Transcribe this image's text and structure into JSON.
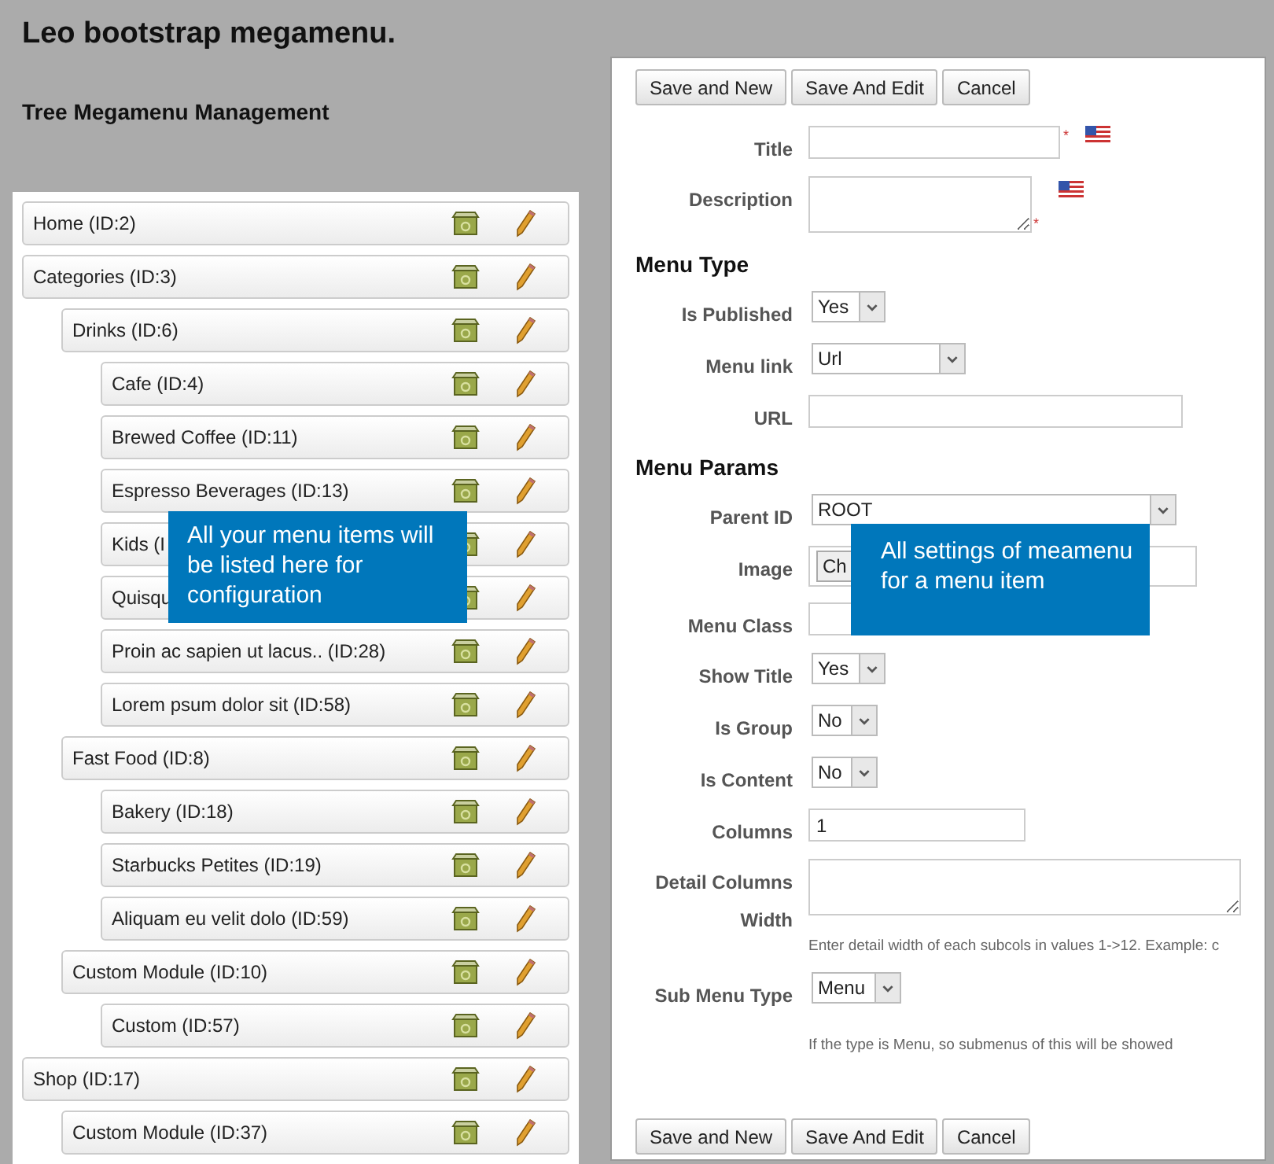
{
  "page_title": "Leo bootstrap megamenu.",
  "tree_title": "Tree Megamenu Management",
  "tree": [
    {
      "label": "Home (ID:2)"
    },
    {
      "label": "Categories (ID:3)",
      "children": [
        {
          "label": "Drinks (ID:6)",
          "children": [
            {
              "label": "Cafe (ID:4)"
            },
            {
              "label": "Brewed Coffee (ID:11)"
            },
            {
              "label": "Espresso Beverages (ID:13)"
            },
            {
              "label": "Kids (I"
            },
            {
              "label": "Quisqu"
            },
            {
              "label": "Proin ac sapien ut lacus.. (ID:28)"
            },
            {
              "label": "Lorem psum dolor sit (ID:58)"
            }
          ]
        },
        {
          "label": "Fast Food (ID:8)",
          "children": [
            {
              "label": "Bakery (ID:18)"
            },
            {
              "label": "Starbucks Petites (ID:19)"
            },
            {
              "label": "Aliquam eu velit dolo (ID:59)"
            }
          ]
        },
        {
          "label": "Custom Module (ID:10)",
          "children": [
            {
              "label": "Custom (ID:57)"
            }
          ]
        }
      ]
    },
    {
      "label": "Shop (ID:17)",
      "children": [
        {
          "label": "Custom Module (ID:37)"
        }
      ]
    }
  ],
  "tree_callout": "All your menu items will be listed here for configuration",
  "buttons_top": [
    "Save and New",
    "Save And Edit",
    "Cancel"
  ],
  "form_rows": [
    {
      "kind": "text",
      "label": "Title",
      "required_mark": "*",
      "flag": true
    },
    {
      "kind": "textarea",
      "label": "Description",
      "required_mark": "*",
      "flag": true
    },
    {
      "kind": "heading",
      "text": "Menu Type"
    },
    {
      "kind": "select",
      "label": "Is Published",
      "value": "Yes"
    },
    {
      "kind": "select",
      "label": "Menu link",
      "value": "Url"
    },
    {
      "kind": "text",
      "label": "URL"
    },
    {
      "kind": "heading",
      "text": "Menu Params"
    },
    {
      "kind": "select",
      "label": "Parent ID",
      "value": "ROOT"
    },
    {
      "kind": "file",
      "label": "Image",
      "value": "Ch"
    },
    {
      "kind": "text",
      "label": "Menu Class"
    },
    {
      "kind": "select",
      "label": "Show Title",
      "value": "Yes"
    },
    {
      "kind": "select",
      "label": "Is Group",
      "value": "No"
    },
    {
      "kind": "select",
      "label": "Is Content",
      "value": "No"
    },
    {
      "kind": "text",
      "label": "Columns",
      "value": "1"
    },
    {
      "kind": "textarea",
      "label": "Detail Columns Width"
    },
    {
      "kind": "help",
      "text": "Enter detail width of each subcols in values 1->12. Example: c"
    },
    {
      "kind": "select",
      "label": "Sub Menu Type",
      "value": "Menu"
    },
    {
      "kind": "help",
      "text": "If the type is Menu, so submenus of this will be showed"
    }
  ],
  "form_callout": "All settings of meamenu for a menu item",
  "buttons_bottom": [
    "Save and New",
    "Save And Edit",
    "Cancel"
  ]
}
